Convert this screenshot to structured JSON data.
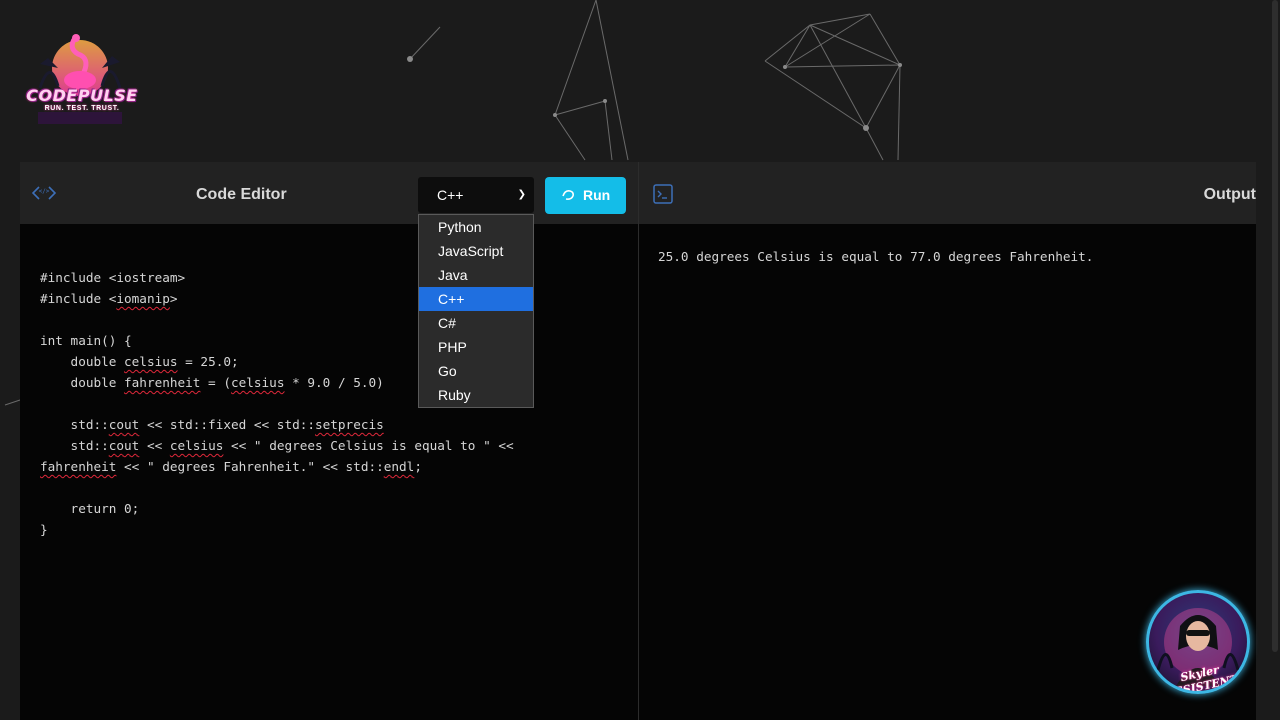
{
  "logo": {
    "name": "CODEPULSE",
    "tagline": "RUN. TEST. TRUST."
  },
  "editor": {
    "title": "Code Editor",
    "language_selected": "C++",
    "run_label": "Run",
    "language_options": [
      "Python",
      "JavaScript",
      "Java",
      "C++",
      "C#",
      "PHP",
      "Go",
      "Ruby"
    ],
    "code_lines": [
      "#include <iostream>",
      "#include <iomanip>",
      "",
      "int main() {",
      "    double celsius = 25.0;",
      "    double fahrenheit = (celsius * 9.0 / 5.0)",
      "",
      "    std::cout << std::fixed << std::setprecis",
      "    std::cout << celsius << \" degrees Celsius is equal to \" <<",
      "fahrenheit << \" degrees Fahrenheit.\" << std::endl;",
      "",
      "    return 0;",
      "}"
    ]
  },
  "output": {
    "title": "Output",
    "text": "25.0 degrees Celsius is equal to 77.0 degrees Fahrenheit."
  },
  "assistant": {
    "label": "Skyler ASSISTENT"
  },
  "colors": {
    "accent": "#14bde8",
    "selected": "#1f6fe0",
    "spell_error": "#e0283a"
  }
}
